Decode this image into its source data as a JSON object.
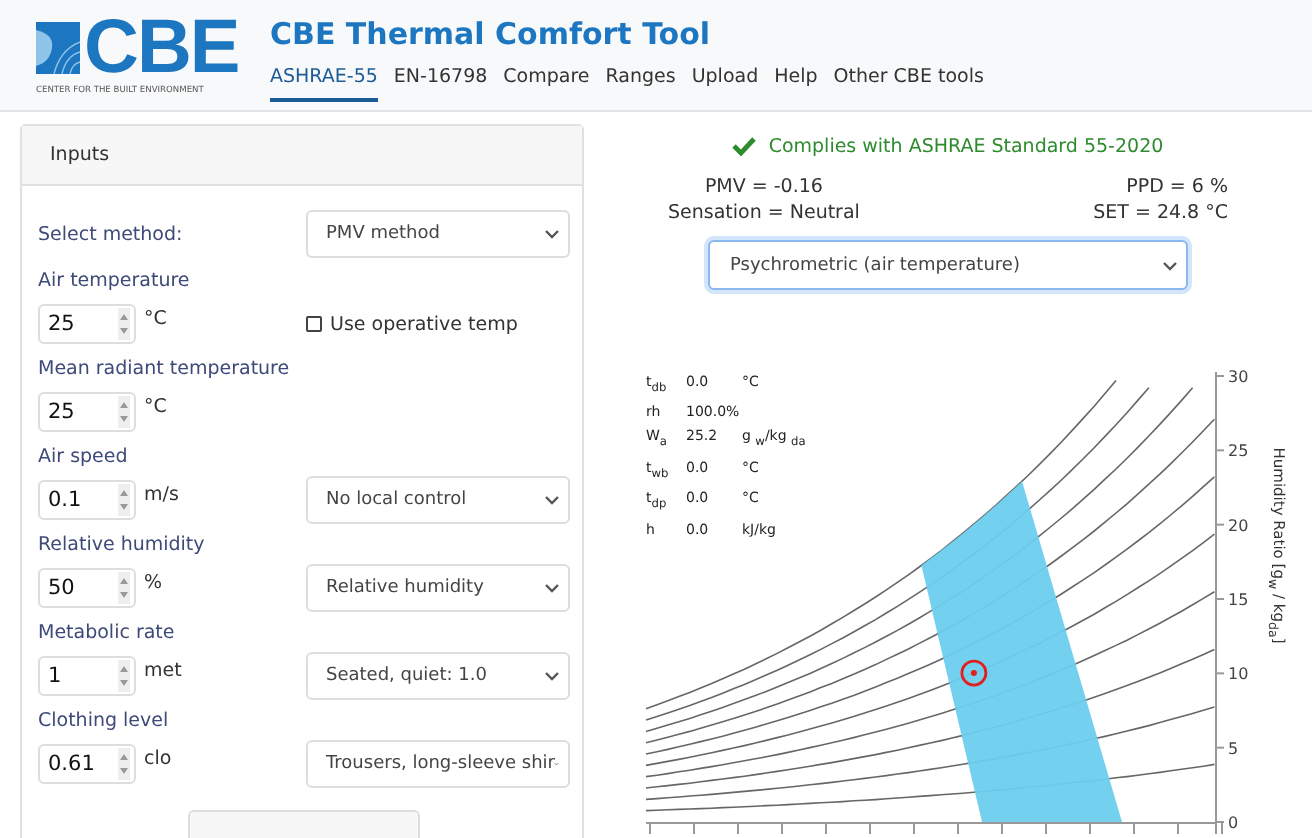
{
  "header": {
    "logo": {
      "text": "CBE",
      "subtitle": "CENTER FOR THE BUILT ENVIRONMENT"
    },
    "title": "CBE Thermal Comfort Tool",
    "nav": [
      {
        "label": "ASHRAE-55",
        "selected": true
      },
      {
        "label": "EN-16798",
        "selected": false
      },
      {
        "label": "Compare",
        "selected": false
      },
      {
        "label": "Ranges",
        "selected": false
      },
      {
        "label": "Upload",
        "selected": false
      },
      {
        "label": "Help",
        "selected": false
      },
      {
        "label": "Other CBE tools",
        "selected": false
      }
    ]
  },
  "inputs_panel": {
    "title": "Inputs",
    "method": {
      "label": "Select method:",
      "value": "PMV method"
    },
    "fields": [
      {
        "label": "Air temperature",
        "value": "25",
        "unit": "°C",
        "kind": "checkbox",
        "option": "Use operative temp",
        "checked": false
      },
      {
        "label": "Mean radiant temperature",
        "value": "25",
        "unit": "°C",
        "kind": "none"
      },
      {
        "label": "Air speed",
        "value": "0.1",
        "unit": "m/s",
        "kind": "select",
        "option": "No local control"
      },
      {
        "label": "Relative humidity",
        "value": "50",
        "unit": "%",
        "kind": "select",
        "option": "Relative humidity"
      },
      {
        "label": "Metabolic rate",
        "value": "1",
        "unit": "met",
        "kind": "select",
        "option": "Seated, quiet: 1.0"
      },
      {
        "label": "Clothing level",
        "value": "0.61",
        "unit": "clo",
        "kind": "select",
        "option": "Trousers, long-sleeve shir"
      }
    ]
  },
  "results": {
    "compliance": {
      "text": "Complies with ASHRAE Standard 55-2020",
      "compliant": true
    },
    "pmv": "PMV = -0.16",
    "ppd": "PPD = 6 %",
    "sensation": "Sensation = Neutral",
    "set": "SET = 24.8 °C",
    "chart_select": "Psychrometric (air temperature)"
  },
  "chart": {
    "readout": [
      {
        "label": "t$_{db}$",
        "value": "0.0",
        "unit": "°C"
      },
      {
        "label": "rh",
        "value": "100.0%"
      },
      {
        "label": "W$_{a}$",
        "value": "25.2",
        "unit": "g $_{w}$/kg $_{da}$"
      },
      {
        "label": "t$_{wb}$",
        "value": "0.0",
        "unit": "°C"
      },
      {
        "label": "t$_{dp}$",
        "value": "0.0",
        "unit": "°C"
      },
      {
        "label": "h",
        "value": "0.0",
        "unit": "kJ/kg"
      }
    ],
    "y_axis": {
      "title": "Humidity Ratio [g$_{w}$ / kg$_{da}$]",
      "ticks": [
        "30",
        "25",
        "20",
        "15",
        "10",
        "5",
        "0"
      ]
    }
  }
}
